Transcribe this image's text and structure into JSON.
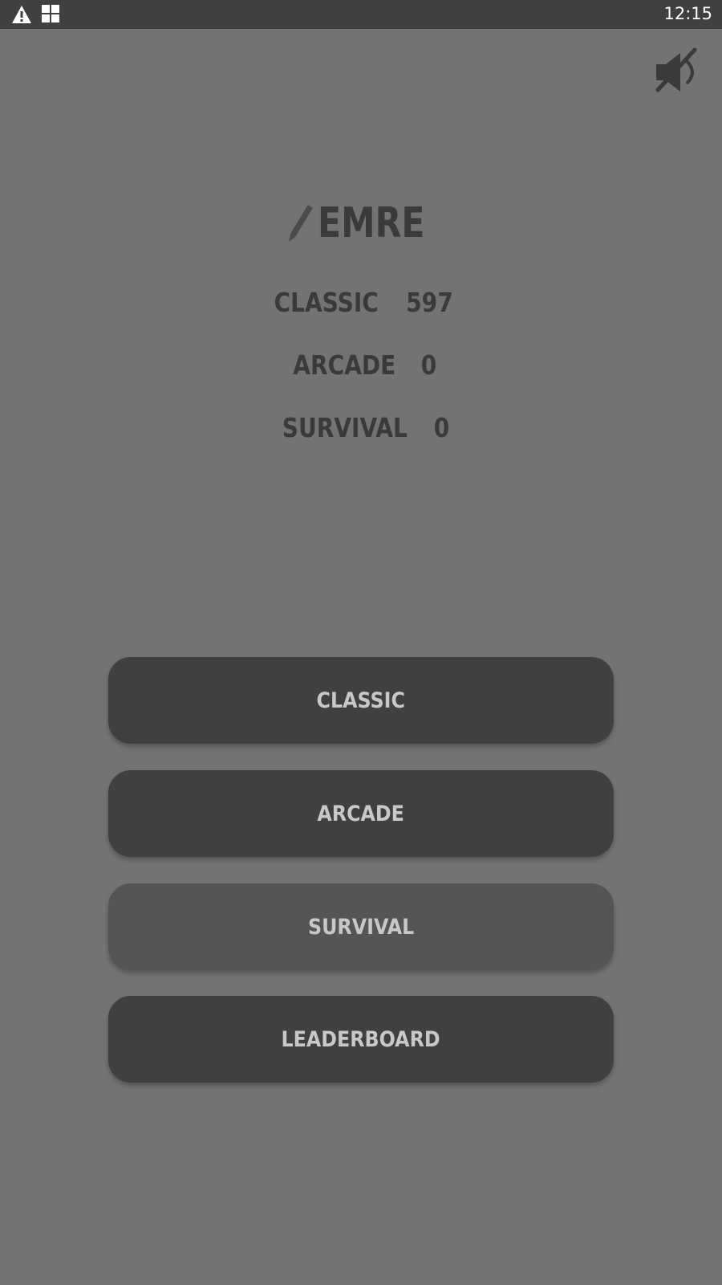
{
  "status_bar": {
    "time": "12:15",
    "icons": [
      "warning-icon",
      "apps-grid-icon"
    ]
  },
  "header": {
    "mute_icon": "volume-muted-icon"
  },
  "profile": {
    "edit_icon": "pencil-icon",
    "name": "EMRE"
  },
  "scores": [
    {
      "label": "CLASSIC",
      "value": "597"
    },
    {
      "label": "ARCADE",
      "value": "0"
    },
    {
      "label": "SURVIVAL",
      "value": "0"
    }
  ],
  "buttons": {
    "classic": "CLASSIC",
    "arcade": "ARCADE",
    "survival": "SURVIVAL",
    "leaderboard": "LEADERBOARD"
  },
  "colors": {
    "background": "#737373",
    "status_bar": "#404040",
    "button": "#404040",
    "button_highlight": "#555555",
    "button_text": "#c8c8c8",
    "text_dark": "#3a3a3a"
  }
}
